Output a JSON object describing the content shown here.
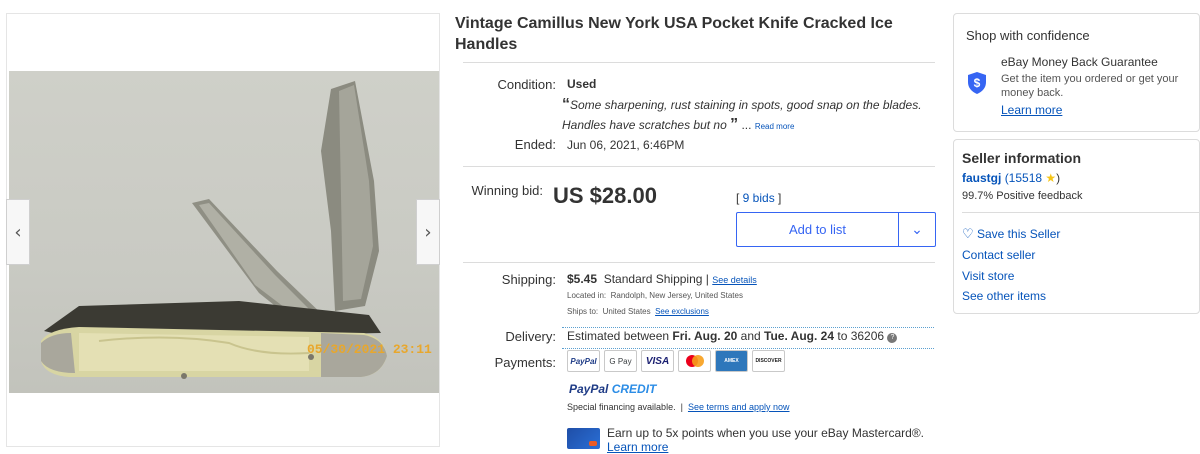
{
  "listing": {
    "title": "Vintage Camillus New York USA Pocket Knife Cracked Ice Handles"
  },
  "gallery": {
    "prev_label": "‹",
    "next_label": "›",
    "photo_timestamp": "05/30/2021 23:11"
  },
  "condition": {
    "label": "Condition:",
    "value": "Used",
    "quote_open": "“",
    "quote": "Some sharpening, rust staining in spots, good snap on the blades. Handles have scratches but no",
    "quote_close": "”",
    "ellipsis": "...",
    "read_more": "Read more"
  },
  "ended": {
    "label": "Ended:",
    "value": "Jun 06, 2021, 6:46PM"
  },
  "bid": {
    "label": "Winning bid:",
    "price": "US $28.00",
    "bids_open": "[ ",
    "bids_link": "9 bids",
    "bids_close": " ]",
    "add_to_list": "Add to list"
  },
  "shipping": {
    "label": "Shipping:",
    "cost": "$5.45",
    "method": "Standard Shipping",
    "separator": "|",
    "see_details": "See details",
    "located_label": "Located in:",
    "located_value": "Randolph, New Jersey, United States",
    "ships_label": "Ships to:",
    "ships_value": "United States",
    "see_exclusions": "See exclusions"
  },
  "delivery": {
    "label": "Delivery:",
    "prefix": "Estimated between ",
    "start": "Fri. Aug. 20",
    "and": " and ",
    "end": "Tue. Aug. 24",
    "suffix": " to 36206"
  },
  "payments": {
    "label": "Payments:",
    "methods": [
      "PayPal",
      "G Pay",
      "VISA",
      "Mastercard",
      "AMERICAN EXPRESS",
      "DISCOVER"
    ],
    "credit_main": "PayPal",
    "credit_sub": "CREDIT",
    "financing": "Special financing available.",
    "separator": "|",
    "financing_link": "See terms and apply now",
    "card_offer": "Earn up to 5x points when you use your eBay Mastercard®.",
    "learn_more": "Learn more"
  },
  "confidence": {
    "title": "Shop with confidence",
    "guarantee_title": "eBay Money Back Guarantee",
    "guarantee_text": "Get the item you ordered or get your money back.",
    "learn_more": "Learn more"
  },
  "seller": {
    "title": "Seller information",
    "name": "faustgj",
    "feedback_score": "(15518",
    "feedback_close": ")",
    "positive": "99.7% Positive feedback",
    "save": "Save this Seller",
    "contact": "Contact seller",
    "store": "Visit store",
    "other_items": "See other items"
  },
  "colors": {
    "link": "#0654ba",
    "button_blue": "#3665f3",
    "text": "#333333"
  }
}
